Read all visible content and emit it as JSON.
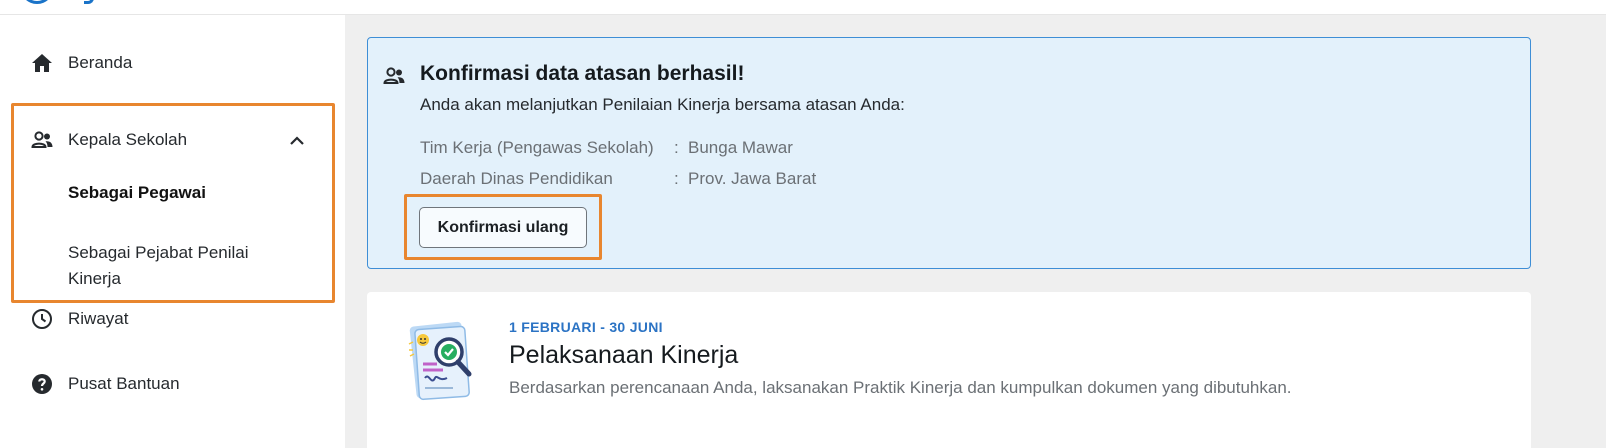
{
  "sidebar": {
    "home_label": "Beranda",
    "group_label": "Kepala Sekolah",
    "sub_items": [
      "Sebagai Pegawai",
      "Sebagai Pejabat Penilai",
      "Kinerja"
    ],
    "history_label": "Riwayat",
    "help_label": "Pusat Bantuan"
  },
  "alert": {
    "title": "Konfirmasi data atasan berhasil!",
    "description": "Anda akan melanjutkan Penilaian Kinerja bersama atasan Anda:",
    "rows": [
      {
        "label": "Tim Kerja (Pengawas Sekolah)",
        "colon": ":",
        "value": "Bunga Mawar"
      },
      {
        "label": "Daerah Dinas Pendidikan",
        "colon": ":",
        "value": "Prov. Jawa Barat"
      }
    ],
    "button_label": "Konfirmasi ulang"
  },
  "card": {
    "date_range": "1 FEBRUARI - 30 JUNI",
    "title": "Pelaksanaan Kinerja",
    "description": "Berdasarkan perencanaan Anda, laksanakan Praktik Kinerja dan kumpulkan dokumen yang dibutuhkan."
  },
  "colors": {
    "accent": "#2b73c4",
    "highlight_border": "#e8862f",
    "alert_bg": "#e3f1fb",
    "alert_border": "#3e8ed6"
  },
  "icons": {
    "home": "home-icon",
    "group": "people-icon",
    "chevron": "chevron-up-icon",
    "history": "clock-icon",
    "help": "help-circle-icon",
    "alert": "people-icon"
  }
}
